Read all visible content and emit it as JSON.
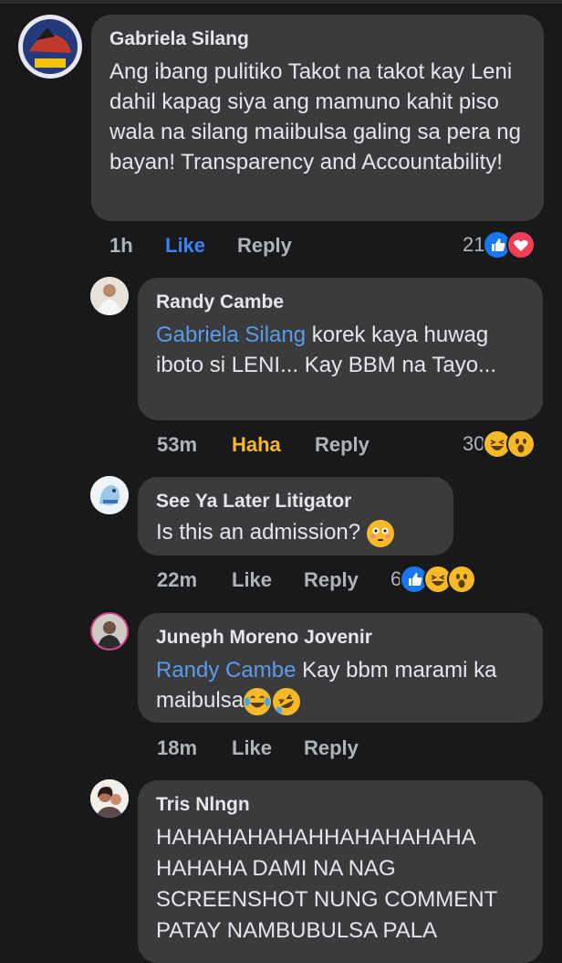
{
  "comments": [
    {
      "author": "Gabriela Silang",
      "mention": "",
      "text": "Ang ibang pulitiko Takot na takot kay Leni dahil kapag siya ang mamuno kahit piso wala na silang maiibulsa galing sa pera ng bayan! Transparency and Accountability!",
      "time": "1h",
      "like": "Like",
      "reply": "Reply",
      "count": "21",
      "reactions": [
        "like-icon",
        "love-icon"
      ]
    },
    {
      "author": "Randy Cambe",
      "mention": "Gabriela Silang",
      "text": " korek kaya huwag iboto si LENI... Kay BBM na Tayo...",
      "time": "53m",
      "like": "Haha",
      "reply": "Reply",
      "count": "30",
      "reactions": [
        "haha-icon",
        "wow-icon"
      ]
    },
    {
      "author": "See Ya Later Litigator",
      "mention": "",
      "text": "Is this an admission? ",
      "emoji": "flushed-face-emoji",
      "time": "22m",
      "like": "Like",
      "reply": "Reply",
      "count": "6",
      "reactions": [
        "like-icon",
        "haha-icon",
        "wow-icon"
      ]
    },
    {
      "author": "Juneph Moreno Jovenir",
      "mention": "Randy Cambe",
      "text": " Kay bbm marami ka maibulsa",
      "emoji": "tears-of-joy-emoji",
      "time": "18m",
      "like": "Like",
      "reply": "Reply",
      "count": ""
    },
    {
      "author": "Tris Nlngn",
      "mention": "",
      "text": "HAHAHAHAHAHHAHAHAHAHA HAHAHA DAMI NA NAG SCREENSHOT NUNG COMMENT PATAY NAMBUBULSA PALA"
    }
  ]
}
